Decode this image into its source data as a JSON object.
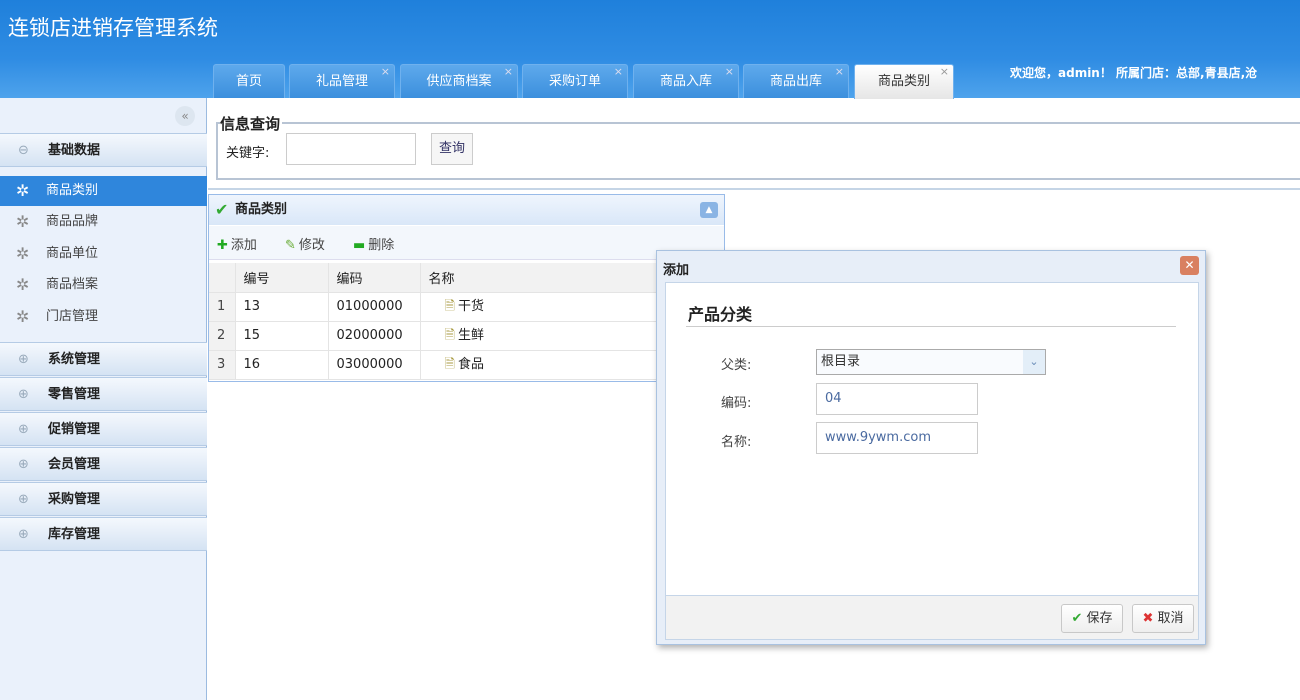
{
  "app_title": "连锁店进销存管理系统",
  "tabs": [
    {
      "label": "首页"
    },
    {
      "label": "礼品管理"
    },
    {
      "label": "供应商档案"
    },
    {
      "label": "采购订单"
    },
    {
      "label": "商品入库"
    },
    {
      "label": "商品出库"
    },
    {
      "label": "商品类别"
    }
  ],
  "close_glyph": "×",
  "welcome": "欢迎您，admin！ 所属门店：总部,青县店,沧",
  "sidebar": {
    "collapse": "«",
    "section": "基础数据",
    "items": [
      "商品类别",
      "商品品牌",
      "商品单位",
      "商品档案",
      "门店管理"
    ],
    "groups": [
      "系统管理",
      "零售管理",
      "促销管理",
      "会员管理",
      "采购管理",
      "库存管理"
    ]
  },
  "query": {
    "legend": "信息查询",
    "keyword_label": "关键字:",
    "keyword_value": "",
    "button": "查询"
  },
  "grid": {
    "title": "商品类别",
    "toolbar": {
      "add": "添加",
      "edit": "修改",
      "delete": "删除"
    },
    "columns": [
      "编号",
      "编码",
      "名称"
    ],
    "rows": [
      {
        "n": "1",
        "id": "13",
        "code": "01000000",
        "name": "干货"
      },
      {
        "n": "2",
        "id": "15",
        "code": "02000000",
        "name": "生鲜"
      },
      {
        "n": "3",
        "id": "16",
        "code": "03000000",
        "name": "食品"
      }
    ]
  },
  "dialog": {
    "title": "添加",
    "form_title": "产品分类",
    "parent_label": "父类:",
    "parent_value": "根目录",
    "code_label": "编码:",
    "code_value": "04",
    "name_label": "名称:",
    "name_value": "www.9ywm.com",
    "save": "保存",
    "cancel": "取消"
  }
}
